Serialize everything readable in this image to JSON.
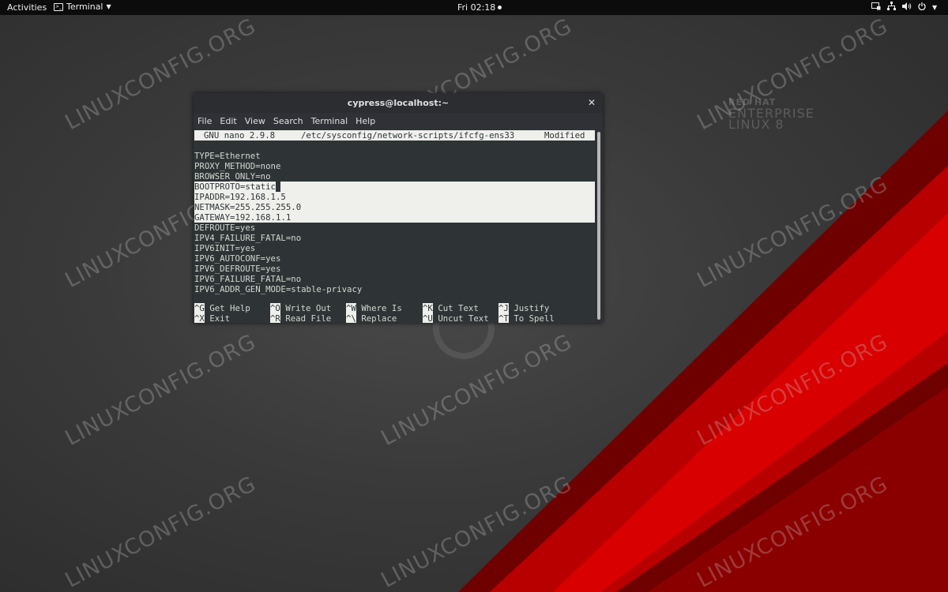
{
  "topbar": {
    "activities": "Activities",
    "app_menu": "Terminal",
    "clock": "Fri 02:18"
  },
  "wallpaper": {
    "logo_line1": "RED HAT",
    "logo_line2": "ENTERPRISE",
    "logo_line3": "LINUX 8",
    "watermark": "LINUXCONFIG.ORG"
  },
  "terminal": {
    "title": "cypress@localhost:~",
    "menu": [
      "File",
      "Edit",
      "View",
      "Search",
      "Terminal",
      "Help"
    ],
    "nano": {
      "version": "GNU nano 2.9.8",
      "path": "/etc/sysconfig/network-scripts/ifcfg-ens33",
      "status": "Modified"
    },
    "lines": [
      "TYPE=Ethernet",
      "PROXY_METHOD=none",
      "BROWSER_ONLY=no",
      "BOOTPROTO=static",
      "IPADDR=192.168.1.5",
      "NETMASK=255.255.255.0",
      "GATEWAY=192.168.1.1",
      "DEFROUTE=yes",
      "IPV4_FAILURE_FATAL=no",
      "IPV6INIT=yes",
      "IPV6_AUTOCONF=yes",
      "IPV6_DEFROUTE=yes",
      "IPV6_FAILURE_FATAL=no",
      "IPV6_ADDR_GEN_MODE=stable-privacy"
    ],
    "selected_lines": [
      3,
      4,
      5,
      6
    ],
    "shortcuts": [
      {
        "key": "^G",
        "label": "Get Help"
      },
      {
        "key": "^O",
        "label": "Write Out"
      },
      {
        "key": "^W",
        "label": "Where Is"
      },
      {
        "key": "^K",
        "label": "Cut Text"
      },
      {
        "key": "^J",
        "label": "Justify"
      },
      {
        "key": "^X",
        "label": "Exit"
      },
      {
        "key": "^R",
        "label": "Read File"
      },
      {
        "key": "^\\",
        "label": "Replace"
      },
      {
        "key": "^U",
        "label": "Uncut Text"
      },
      {
        "key": "^T",
        "label": "To Spell"
      }
    ]
  },
  "colors": {
    "red_dark": "#7a0000",
    "red_mid": "#b30000",
    "red_bright": "#d40000"
  }
}
